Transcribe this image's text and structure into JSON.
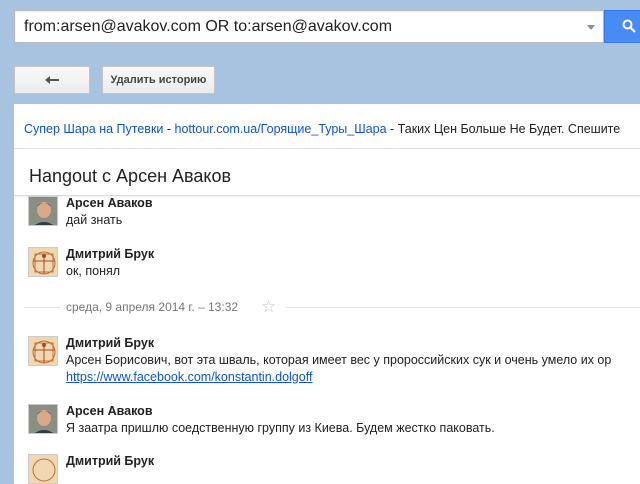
{
  "search": {
    "query": "from:arsen@avakov.com OR to:arsen@avakov.com"
  },
  "toolbar": {
    "delete_label": "Удалить историю"
  },
  "ad": {
    "title": "Супер Шара на Путевки",
    "sep1": " - ",
    "url": "hottour.com.ua/Горящие_Туры_Шара",
    "sep2": " - ",
    "desc": "Таких Цен Больше Не Будет. Спешите"
  },
  "conversation": {
    "title": "Hangout с Арсен Аваков"
  },
  "date_divider": "среда, 9 апреля 2014 г.   – 13:32",
  "messages": [
    {
      "sender": "Арсен Аваков",
      "text": "дай знать"
    },
    {
      "sender": "Дмитрий Брук",
      "text": "ок, понял"
    },
    {
      "sender": "Дмитрий Брук",
      "text": "Арсен Борисович, вот эта шваль, которая имеет вес у пророссийских сук и очень умело их ор",
      "link": "https://www.facebook.com/konstantin.dolgoff"
    },
    {
      "sender": "Арсен Аваков",
      "text": "Я заатра пришлю соедственную группу из Киева. Будем жестко паковать."
    },
    {
      "sender": "Дмитрий Брук"
    }
  ],
  "colors": {
    "accent": "#4a8af4",
    "link": "#1155cc",
    "background": "#a7c3df"
  }
}
